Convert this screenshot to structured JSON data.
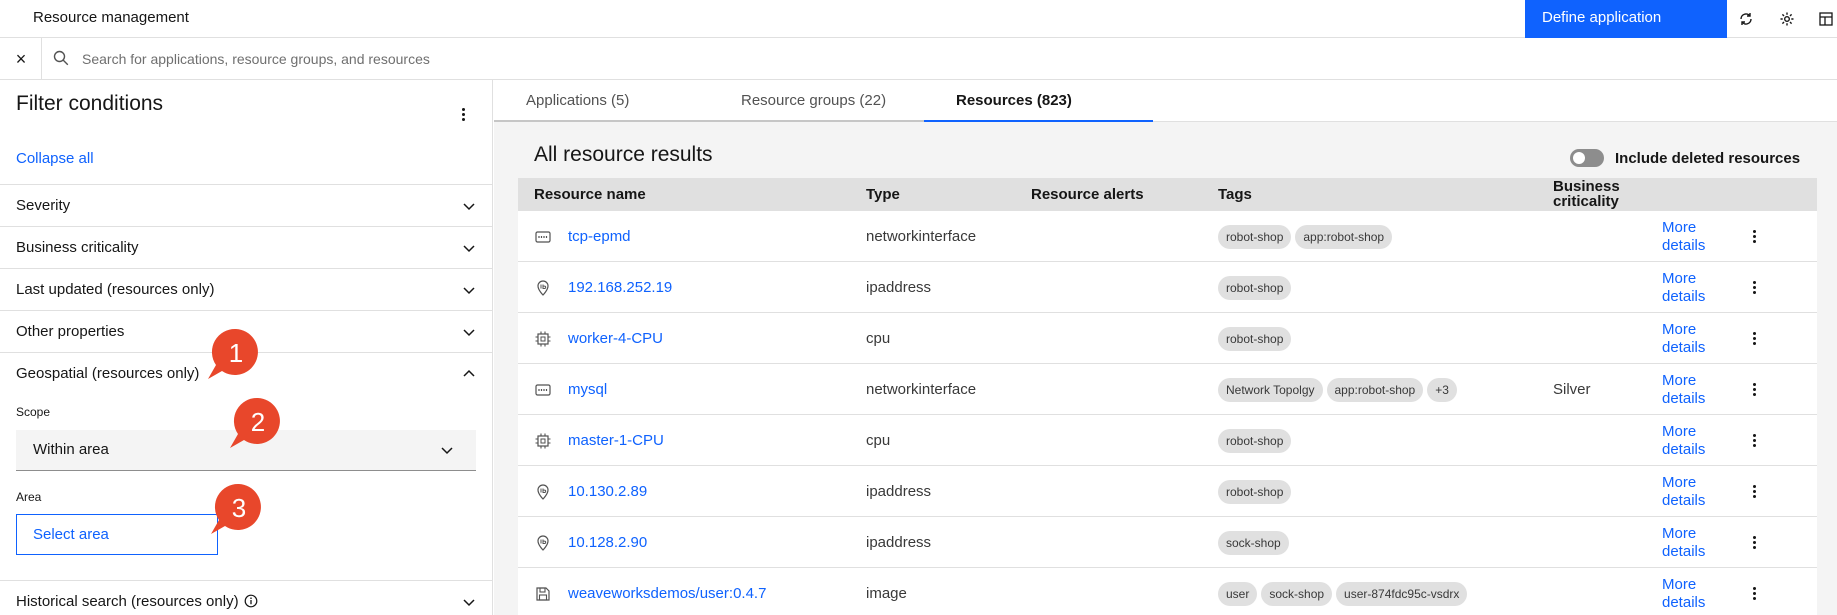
{
  "header": {
    "title": "Resource management",
    "define_button": "Define application",
    "icons": [
      "refresh-icon",
      "settings-icon",
      "dashboard-icon"
    ]
  },
  "search": {
    "placeholder": "Search for applications, resource groups, and resources"
  },
  "filters": {
    "title": "Filter conditions",
    "collapse_all": "Collapse all",
    "sections": [
      {
        "label": "Severity",
        "expanded": false
      },
      {
        "label": "Business criticality",
        "expanded": false
      },
      {
        "label": "Last updated (resources only)",
        "expanded": false
      },
      {
        "label": "Other properties",
        "expanded": false
      },
      {
        "label": "Geospatial (resources only)",
        "expanded": true
      }
    ],
    "scope_label": "Scope",
    "scope_value": "Within area",
    "area_label": "Area",
    "area_button": "Select area",
    "historical": "Historical search (resources only)"
  },
  "callouts": [
    "1",
    "2",
    "3"
  ],
  "tabs": [
    {
      "label": "Applications (5)",
      "active": false
    },
    {
      "label": "Resource groups (22)",
      "active": false
    },
    {
      "label": "Resources (823)",
      "active": true
    }
  ],
  "results": {
    "title": "All resource results",
    "toggle_label": "Include deleted resources",
    "toggle_on": false,
    "columns": [
      "Resource name",
      "Type",
      "Resource alerts",
      "Tags",
      "Business criticality"
    ],
    "more_details": "More details",
    "rows": [
      {
        "icon": "network-interface-icon",
        "name": "tcp-epmd",
        "type": "networkinterface",
        "alerts": "",
        "tags": [
          "robot-shop",
          "app:robot-shop"
        ],
        "criticality": ""
      },
      {
        "icon": "ip-address-icon",
        "name": "192.168.252.19",
        "type": "ipaddress",
        "alerts": "",
        "tags": [
          "robot-shop"
        ],
        "criticality": ""
      },
      {
        "icon": "cpu-icon",
        "name": "worker-4-CPU",
        "type": "cpu",
        "alerts": "",
        "tags": [
          "robot-shop"
        ],
        "criticality": ""
      },
      {
        "icon": "network-interface-icon",
        "name": "mysql",
        "type": "networkinterface",
        "alerts": "",
        "tags": [
          "Network Topolgy",
          "app:robot-shop",
          "+3"
        ],
        "criticality": "Silver"
      },
      {
        "icon": "cpu-icon",
        "name": "master-1-CPU",
        "type": "cpu",
        "alerts": "",
        "tags": [
          "robot-shop"
        ],
        "criticality": ""
      },
      {
        "icon": "ip-address-icon",
        "name": "10.130.2.89",
        "type": "ipaddress",
        "alerts": "",
        "tags": [
          "robot-shop"
        ],
        "criticality": ""
      },
      {
        "icon": "ip-address-icon",
        "name": "10.128.2.90",
        "type": "ipaddress",
        "alerts": "",
        "tags": [
          "sock-shop"
        ],
        "criticality": ""
      },
      {
        "icon": "image-icon",
        "name": "weaveworksdemos/user:0.4.7",
        "type": "image",
        "alerts": "",
        "tags": [
          "user",
          "sock-shop",
          "user-874fdc95c-vsdrx"
        ],
        "criticality": ""
      }
    ]
  },
  "colors": {
    "accent": "#0f62fe",
    "callout": "#e8472b"
  }
}
